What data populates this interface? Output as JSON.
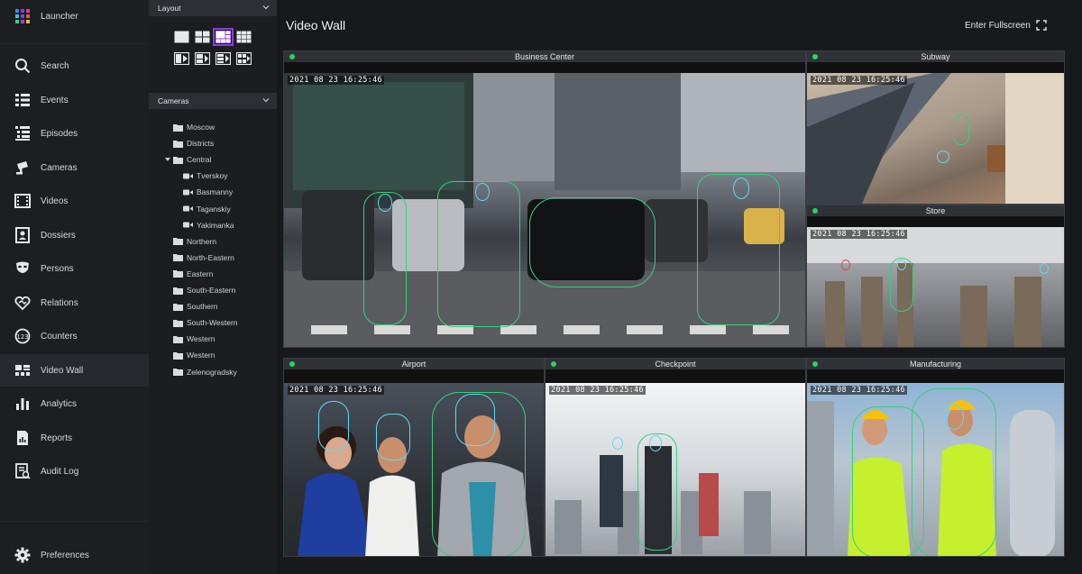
{
  "nav": {
    "items": [
      {
        "label": "Launcher",
        "icon": "launcher-grid-icon"
      },
      {
        "label": "Search",
        "icon": "search-icon"
      },
      {
        "label": "Events",
        "icon": "events-list-icon"
      },
      {
        "label": "Episodes",
        "icon": "episodes-icon"
      },
      {
        "label": "Cameras",
        "icon": "camera-icon"
      },
      {
        "label": "Videos",
        "icon": "film-icon"
      },
      {
        "label": "Dossiers",
        "icon": "dossier-icon"
      },
      {
        "label": "Persons",
        "icon": "person-mask-icon"
      },
      {
        "label": "Relations",
        "icon": "relations-heart-icon"
      },
      {
        "label": "Counters",
        "icon": "counter-icon"
      },
      {
        "label": "Video Wall",
        "icon": "video-wall-icon",
        "active": true
      },
      {
        "label": "Analytics",
        "icon": "bar-chart-icon"
      },
      {
        "label": "Reports",
        "icon": "report-icon"
      },
      {
        "label": "Audit Log",
        "icon": "audit-log-icon"
      }
    ],
    "preferences": "Preferences",
    "accent": "#8b3fd9"
  },
  "panel": {
    "layout_title": "Layout",
    "cameras_title": "Cameras",
    "tree": [
      {
        "label": "Moscow",
        "type": "folder",
        "level": 0
      },
      {
        "label": "Districts",
        "type": "folder",
        "level": 0
      },
      {
        "label": "Central",
        "type": "folder",
        "level": 0,
        "expanded": true
      },
      {
        "label": "Tverskoy",
        "type": "camera",
        "level": 1
      },
      {
        "label": "Basmanny",
        "type": "camera",
        "level": 1
      },
      {
        "label": "Taganskiy",
        "type": "camera",
        "level": 1
      },
      {
        "label": "Yakimanka",
        "type": "camera",
        "level": 1
      },
      {
        "label": "Northern",
        "type": "folder",
        "level": 0
      },
      {
        "label": "North-Eastern",
        "type": "folder",
        "level": 0
      },
      {
        "label": "Eastern",
        "type": "folder",
        "level": 0
      },
      {
        "label": "South-Eastern",
        "type": "folder",
        "level": 0
      },
      {
        "label": "Southern",
        "type": "folder",
        "level": 0
      },
      {
        "label": "South-Western",
        "type": "folder",
        "level": 0
      },
      {
        "label": "Western",
        "type": "folder",
        "level": 0
      },
      {
        "label": "Western",
        "type": "folder",
        "level": 0
      },
      {
        "label": "Zelenogradsky",
        "type": "folder",
        "level": 0
      }
    ]
  },
  "main": {
    "title": "Video Wall",
    "fullscreen_label": "Enter Fullscreen",
    "timestamp": "2021  08  23  16:25:46",
    "cells": [
      {
        "name": "Business Center"
      },
      {
        "name": "Subway"
      },
      {
        "name": "Store"
      },
      {
        "name": "Airport"
      },
      {
        "name": "Checkpoint"
      },
      {
        "name": "Manufacturing"
      }
    ],
    "status_color": "#2bd35b"
  }
}
